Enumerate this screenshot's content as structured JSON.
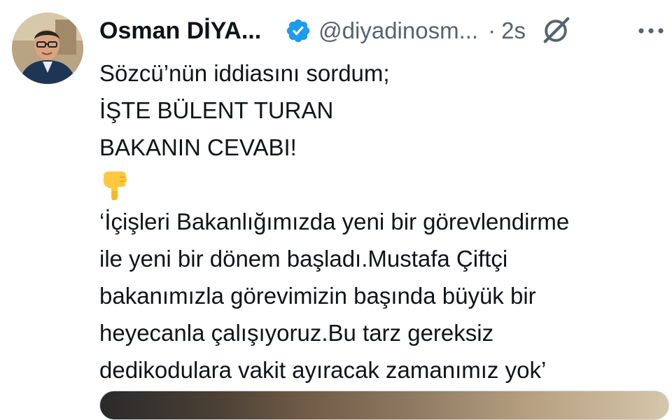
{
  "tweet": {
    "author_name": "Osman DİYA...",
    "handle": "@diyadinosm...",
    "separator": "·",
    "time": "2s",
    "lines": [
      "Sözcü’nün iddiasını sordum;",
      "İŞTE BÜLENT TURAN",
      "BAKANIN CEVABI!"
    ],
    "quote_lines": [
      "‘İçişleri Bakanlığımızda yeni bir görevlendirme",
      "ile yeni bir dönem başladı.Mustafa Çiftçi",
      "bakanımızla görevimizin başında büyük bir",
      "heyecanla çalışıyoruz.Bu tarz gereksiz",
      "dedikodulara vakit ayıracak zamanımız yok’"
    ]
  },
  "icons": {
    "verified": "verified-badge-icon",
    "grok": "grok-icon",
    "more": "more-options-icon",
    "emoji": "backhand-index-pointing-down-emoji"
  },
  "colors": {
    "verified_blue": "#1d9bf0",
    "secondary_text": "#536471",
    "primary_text": "#0f1419"
  }
}
